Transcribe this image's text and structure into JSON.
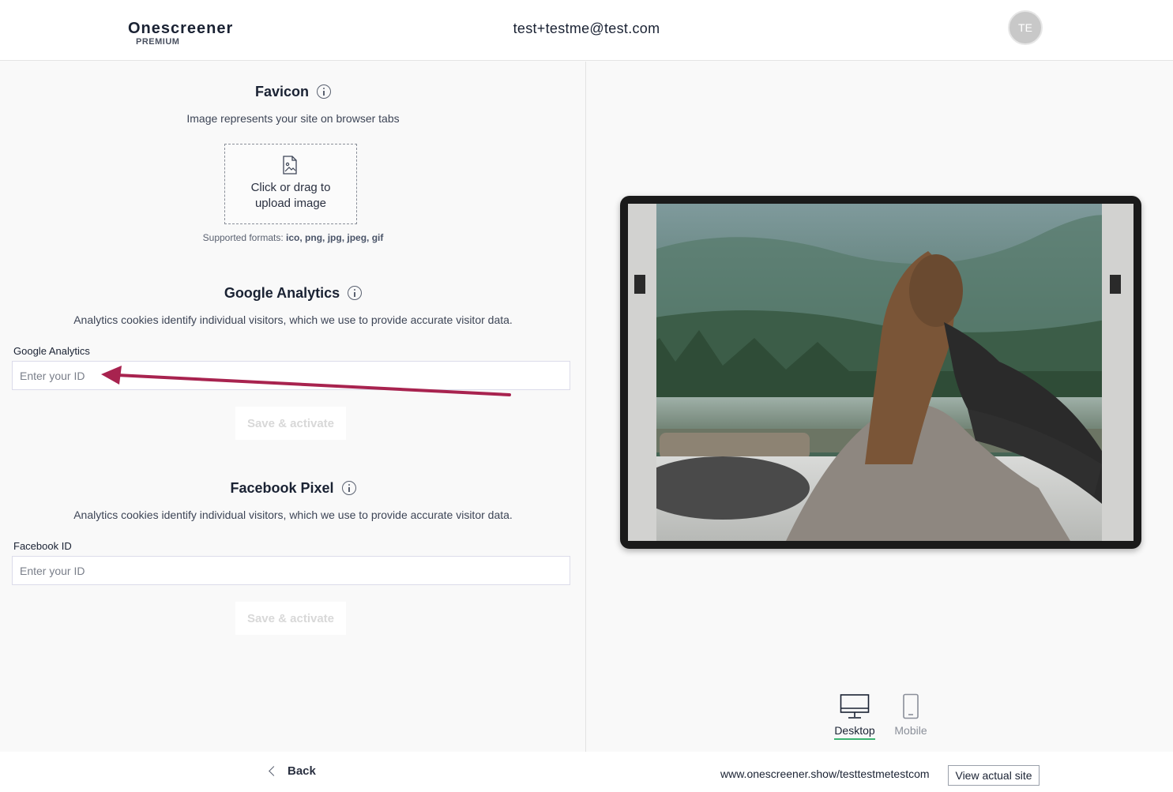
{
  "header": {
    "brand_name": "Onescreener",
    "brand_tier": "PREMIUM",
    "user_email": "test+testme@test.com",
    "avatar_initials": "TE"
  },
  "favicon": {
    "title": "Favicon",
    "description": "Image represents your site on browser tabs",
    "upload_line1": "Click or drag to",
    "upload_line2": "upload image",
    "formats_label": "Supported formats: ",
    "formats_list": "ico, png, jpg, jpeg, gif"
  },
  "google_analytics": {
    "title": "Google Analytics",
    "description": "Analytics cookies identify individual visitors, which we use to provide accurate visitor data.",
    "field_label": "Google Analytics",
    "placeholder": "Enter your ID",
    "value": "",
    "save_label": "Save & activate"
  },
  "facebook_pixel": {
    "title": "Facebook Pixel",
    "description": "Analytics cookies identify individual visitors, which we use to provide accurate visitor data.",
    "field_label": "Facebook ID",
    "placeholder": "Enter your ID",
    "value": "",
    "save_label": "Save & activate"
  },
  "preview": {
    "views": [
      {
        "label": "Desktop",
        "icon": "desktop-icon",
        "active": true
      },
      {
        "label": "Mobile",
        "icon": "mobile-icon",
        "active": false
      }
    ]
  },
  "footer": {
    "back_label": "Back",
    "site_url": "www.onescreener.show/testtestmetestcom",
    "view_site_label": "View actual site"
  },
  "colors": {
    "arrow": "#a8234f",
    "active_underline": "#3cb371",
    "disabled_text": "#d8d8d8"
  }
}
